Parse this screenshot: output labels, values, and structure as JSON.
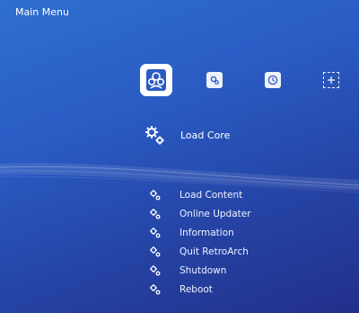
{
  "header": {
    "title": "Main Menu"
  },
  "tabs": [
    {
      "icon": "main-menu-icon",
      "active": true
    },
    {
      "icon": "settings-icon"
    },
    {
      "icon": "history-icon"
    },
    {
      "icon": "add-icon"
    }
  ],
  "selected": {
    "label": "Load Core",
    "icon": "gear-icon"
  },
  "menu": {
    "items": [
      {
        "label": "Load Content",
        "icon": "gear-icon"
      },
      {
        "label": "Online Updater",
        "icon": "gear-icon"
      },
      {
        "label": "Information",
        "icon": "gear-icon"
      },
      {
        "label": "Quit RetroArch",
        "icon": "gear-icon"
      },
      {
        "label": "Shutdown",
        "icon": "gear-icon"
      },
      {
        "label": "Reboot",
        "icon": "gear-icon"
      }
    ]
  },
  "colors": {
    "accent": "#2a5cc4",
    "text": "#ffffff"
  }
}
